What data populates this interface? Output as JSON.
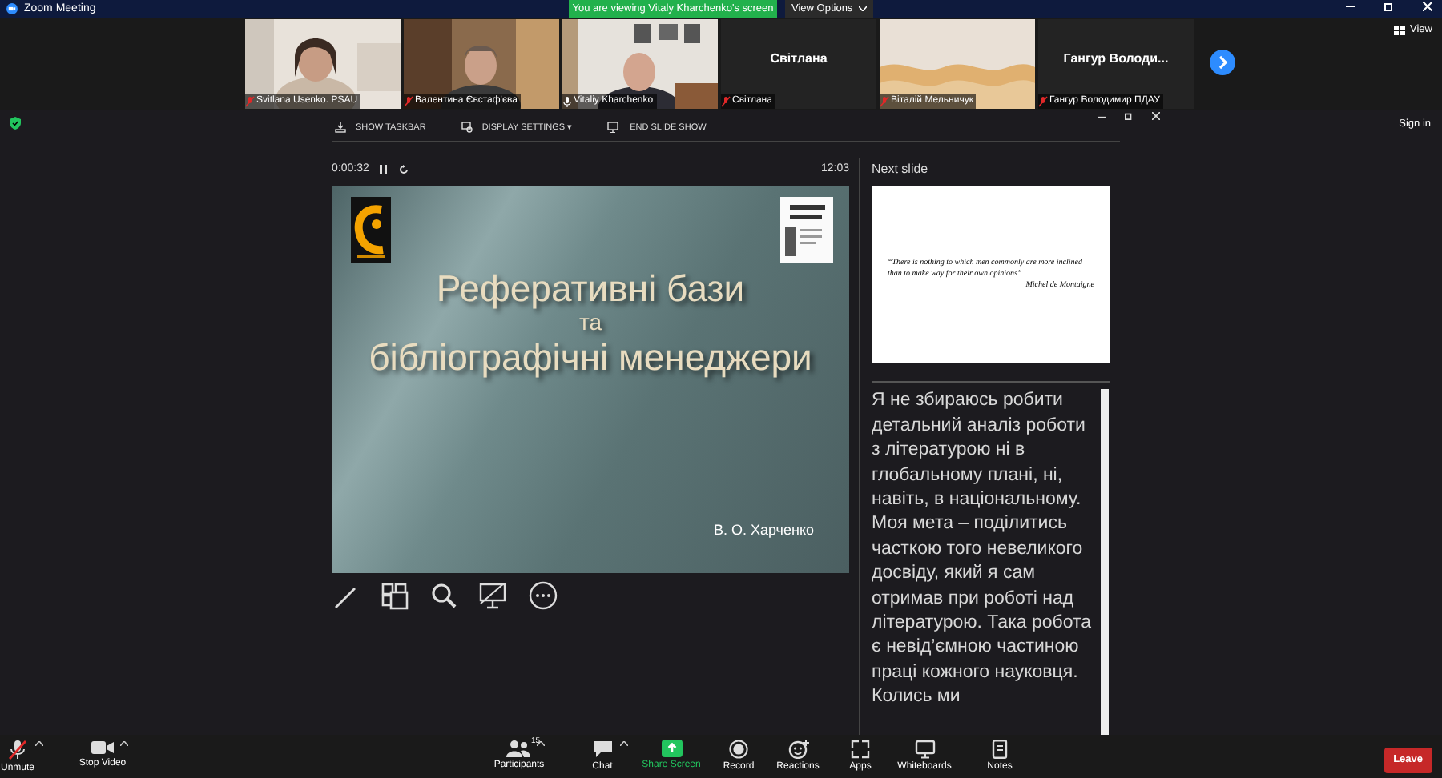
{
  "window": {
    "title": "Zoom Meeting"
  },
  "banner": {
    "text": "You are viewing Vitaly Kharchenko's screen",
    "view_options": "View Options"
  },
  "view_button": "View",
  "participants": [
    {
      "name": "Svitlana Usenko. PSAU",
      "kind": "video",
      "muted": true
    },
    {
      "name": "Валентина Євстаф'єва",
      "kind": "video",
      "muted": true
    },
    {
      "name": "Vitaliy Kharchenko",
      "kind": "video",
      "muted": false
    },
    {
      "name": "Світлана",
      "kind": "name",
      "display_name": "Світлана",
      "muted": true
    },
    {
      "name": "Віталій Мельничук",
      "kind": "video",
      "muted": true
    },
    {
      "name": "Гангур Володимир ПДАУ",
      "kind": "name",
      "display_name": "Гангур  Володи...",
      "muted": true
    }
  ],
  "sign_in": "Sign in",
  "presenter": {
    "toolbar": [
      {
        "kind": "taskbar",
        "label": "SHOW TASKBAR"
      },
      {
        "kind": "display",
        "label": "DISPLAY SETTINGS ▾"
      },
      {
        "kind": "end",
        "label": "END SLIDE SHOW"
      }
    ],
    "elapsed": "0:00:32",
    "clock": "12:03",
    "next_label": "Next slide",
    "slide": {
      "title": "Реферативні бази",
      "connector": "та",
      "subtitle": "бібліографічні менеджери",
      "author": "В. О. Харченко"
    },
    "next_slide": {
      "quote": "“There is nothing to which men commonly are more inclined than to make way for their own opinions”",
      "attribution": "Michel de Montaigne"
    },
    "notes": "Я не збираюсь робити детальний аналіз роботи з літературою ні в глобальному плані, ні, навіть, в національному. Моя мета – поділитись часткою того невеликого досвіду, який я сам отримав при роботі над літературою. Така робота є невід’ємною частиною праці кожного науковця. Колись ми"
  },
  "toolbar": [
    {
      "kind": "mic",
      "label": "Unmute",
      "caret": true
    },
    {
      "kind": "video",
      "label": "Stop Video",
      "caret": true
    },
    {
      "kind": "participants",
      "label": "Participants",
      "badge": "15",
      "caret": true
    },
    {
      "kind": "chat",
      "label": "Chat",
      "caret": true
    },
    {
      "kind": "share",
      "label": "Share Screen",
      "caret": false
    },
    {
      "kind": "record",
      "label": "Record",
      "caret": false
    },
    {
      "kind": "reactions",
      "label": "Reactions",
      "caret": false
    },
    {
      "kind": "apps",
      "label": "Apps",
      "caret": false
    },
    {
      "kind": "whiteboards",
      "label": "Whiteboards",
      "caret": false
    },
    {
      "kind": "notes",
      "label": "Notes",
      "caret": false
    }
  ],
  "leave": "Leave"
}
